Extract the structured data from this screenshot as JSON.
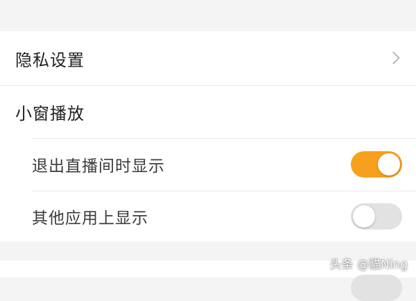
{
  "settings": {
    "privacy": {
      "label": "隐私设置"
    },
    "mini_window": {
      "label": "小窗播放"
    },
    "exit_live_display": {
      "label": "退出直播间时显示",
      "enabled": true
    },
    "other_apps_display": {
      "label": "其他应用上显示",
      "enabled": false
    }
  },
  "watermark": {
    "text": "头条 @貓Ning"
  },
  "colors": {
    "toggle_on": "#f7a01b",
    "toggle_off": "#e2e2e2",
    "background": "#f4f4f4",
    "card": "#ffffff"
  },
  "icons": {
    "privacy_chevron": "chevron-right-icon"
  }
}
